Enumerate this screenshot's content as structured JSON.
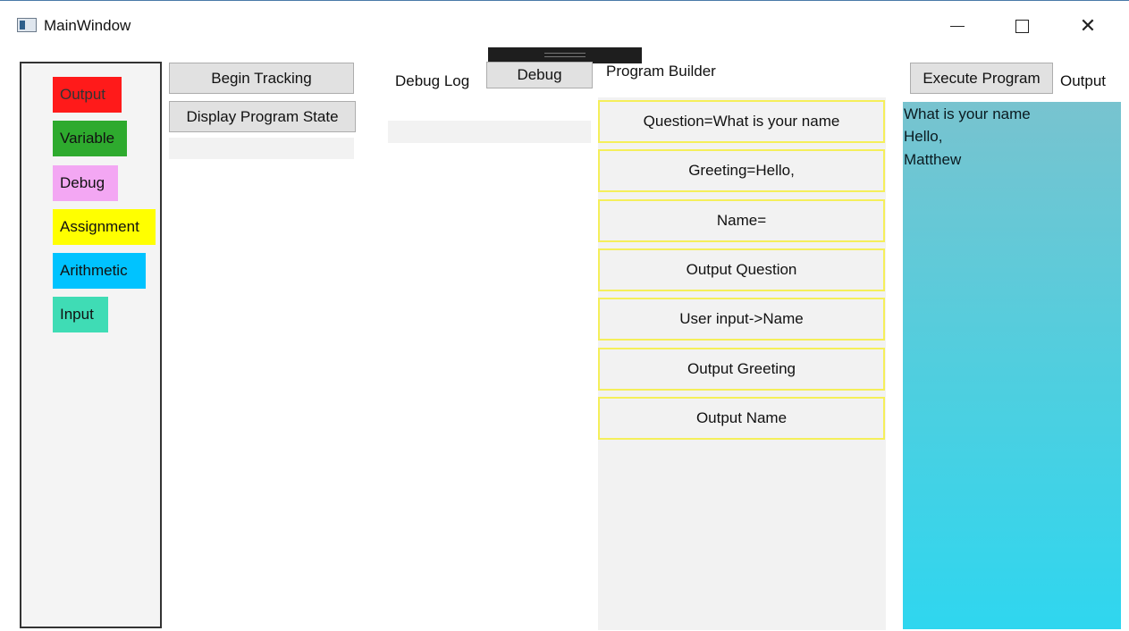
{
  "window": {
    "title": "MainWindow"
  },
  "toolbox": {
    "items": [
      {
        "label": "Output",
        "color": "#ff1a1a"
      },
      {
        "label": "Variable",
        "color": "#2eaa2e"
      },
      {
        "label": "Debug",
        "color": "#f3a7f3"
      },
      {
        "label": "Assignment",
        "color": "#ffff00"
      },
      {
        "label": "Arithmetic",
        "color": "#00c3ff"
      },
      {
        "label": "Input",
        "color": "#3fdcb5"
      }
    ]
  },
  "controls": {
    "begin_tracking": "Begin Tracking",
    "display_state": "Display Program State",
    "debug_log_label": "Debug Log",
    "debug_button": "Debug",
    "program_builder_label": "Program Builder",
    "execute_button": "Execute Program",
    "output_label": "Output"
  },
  "program": {
    "steps": [
      "Question=What is your name",
      "Greeting=Hello,",
      "Name=",
      "Output Question",
      "User input->Name",
      "Output Greeting",
      "Output Name"
    ]
  },
  "output": {
    "lines": [
      "What is your name",
      "Hello,",
      "Matthew"
    ]
  },
  "icons": [
    "app-icon",
    "minimize-icon",
    "maximize-icon",
    "close-icon",
    "grip-icon"
  ]
}
